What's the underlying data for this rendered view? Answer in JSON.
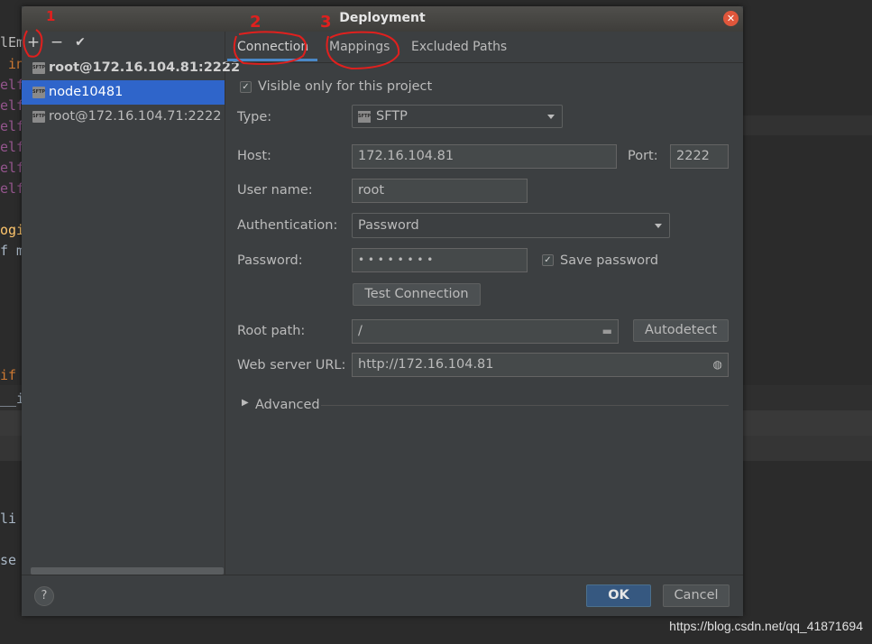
{
  "window": {
    "title": "Deployment",
    "close_icon": "close-icon"
  },
  "background": {
    "lines": [
      {
        "text": "lEm",
        "color": "#a9b7c6"
      },
      {
        "text": " in",
        "color": "#cc7832"
      },
      {
        "text": "elf",
        "color": "#94558d"
      },
      {
        "text": "elf",
        "color": "#94558d"
      },
      {
        "text": "elf",
        "color": "#94558d"
      },
      {
        "text": "elf",
        "color": "#94558d"
      },
      {
        "text": "elf",
        "color": "#94558d"
      },
      {
        "text": "elf",
        "color": "#94558d"
      },
      {
        "text": "ogi",
        "color": "#ffc66d"
      },
      {
        "text": "f m",
        "color": "#a9b7c6"
      },
      {
        "text": "if",
        "color": "#cc7832"
      },
      {
        "text": "__i",
        "color": "#a9b7c6"
      },
      {
        "text": "li",
        "color": "#a9b7c6"
      },
      {
        "text": "se",
        "color": "#a9b7c6"
      }
    ]
  },
  "toolbar": {
    "add_label": "+",
    "remove_label": "−",
    "apply_label": "✔"
  },
  "servers": [
    {
      "name": "root@172.16.104.81:2222",
      "bold": true,
      "selected": false
    },
    {
      "name": "node10481",
      "bold": false,
      "selected": true
    },
    {
      "name": "root@172.16.104.71:2222",
      "bold": false,
      "selected": false
    }
  ],
  "sftp_icon_text": "SFTP",
  "tabs": [
    {
      "label": "Connection",
      "active": true
    },
    {
      "label": "Mappings",
      "active": false
    },
    {
      "label": "Excluded Paths",
      "active": false
    }
  ],
  "form": {
    "visible_only_label": "Visible only for this project",
    "visible_only_checked": true,
    "type_label": "Type:",
    "type_value": "SFTP",
    "host_label": "Host:",
    "host_value": "172.16.104.81",
    "port_label": "Port:",
    "port_value": "2222",
    "username_label": "User name:",
    "username_value": "root",
    "auth_label": "Authentication:",
    "auth_value": "Password",
    "password_label": "Password:",
    "password_value": "• • • • • • • •",
    "save_password_label": "Save password",
    "save_password_checked": true,
    "test_connection_label": "Test Connection",
    "root_path_label": "Root path:",
    "root_path_value": "/",
    "autodetect_label": "Autodetect",
    "web_url_label": "Web server URL:",
    "web_url_value": "http://172.16.104.81",
    "advanced_label": "Advanced"
  },
  "footer": {
    "help_label": "?",
    "ok_label": "OK",
    "cancel_label": "Cancel"
  },
  "annotations": [
    "1",
    "2",
    "3"
  ],
  "watermark": "https://blog.csdn.net/qq_41871694",
  "colors": {
    "accent": "#2f65ca",
    "tab_underline": "#4a88c7",
    "annotation": "#e0201e"
  }
}
